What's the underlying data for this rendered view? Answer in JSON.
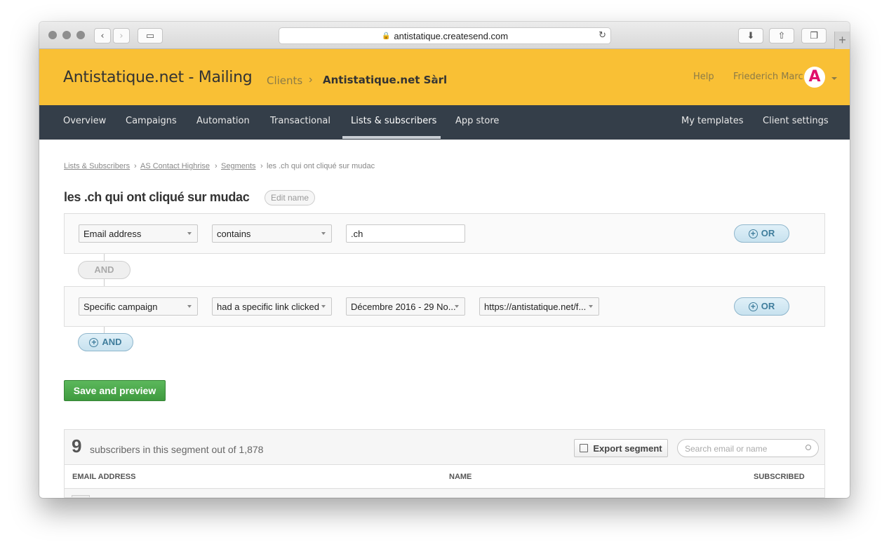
{
  "browser": {
    "url": "antistatique.createsend.com"
  },
  "header": {
    "brand": "Antistatique.net - Mailing",
    "clients_label": "Clients",
    "separator": "›",
    "client_name": "Antistatique.net Sàrl",
    "help_label": "Help",
    "user_name": "Friederich Marc",
    "avatar_letter": "A"
  },
  "nav": {
    "items": [
      "Overview",
      "Campaigns",
      "Automation",
      "Transactional",
      "Lists & subscribers",
      "App store"
    ],
    "right_items": [
      "My templates",
      "Client settings"
    ],
    "active_index": 4
  },
  "breadcrumb": {
    "items": [
      "Lists & Subscribers",
      "AS Contact Highrise",
      "Segments",
      "les .ch qui ont cliqué sur mudac"
    ],
    "separator": "›"
  },
  "segment": {
    "title": "les .ch qui ont cliqué sur mudac",
    "edit_name_label": "Edit name"
  },
  "rules": [
    {
      "field": "Email address",
      "operator": "contains",
      "value": ".ch",
      "or_label": "OR"
    },
    {
      "field": "Specific campaign",
      "operator": "had a specific link clicked",
      "campaign": "Décembre 2016 - 29 No...",
      "link": "https://antistatique.net/f...",
      "or_label": "OR"
    }
  ],
  "and_connector_label": "AND",
  "add_and_label": "AND",
  "save_label": "Save and preview",
  "results": {
    "count": "9",
    "summary": "subscribers in this segment out of 1,878",
    "export_label": "Export segment",
    "search_placeholder": "Search email or name",
    "columns": [
      "EMAIL ADDRESS",
      "NAME",
      "SUBSCRIBED"
    ]
  },
  "colors": {
    "header_bg": "#f9c035",
    "nav_bg": "#343e49",
    "save_green": "#4cae4c",
    "avatar_pink": "#e0106a"
  }
}
